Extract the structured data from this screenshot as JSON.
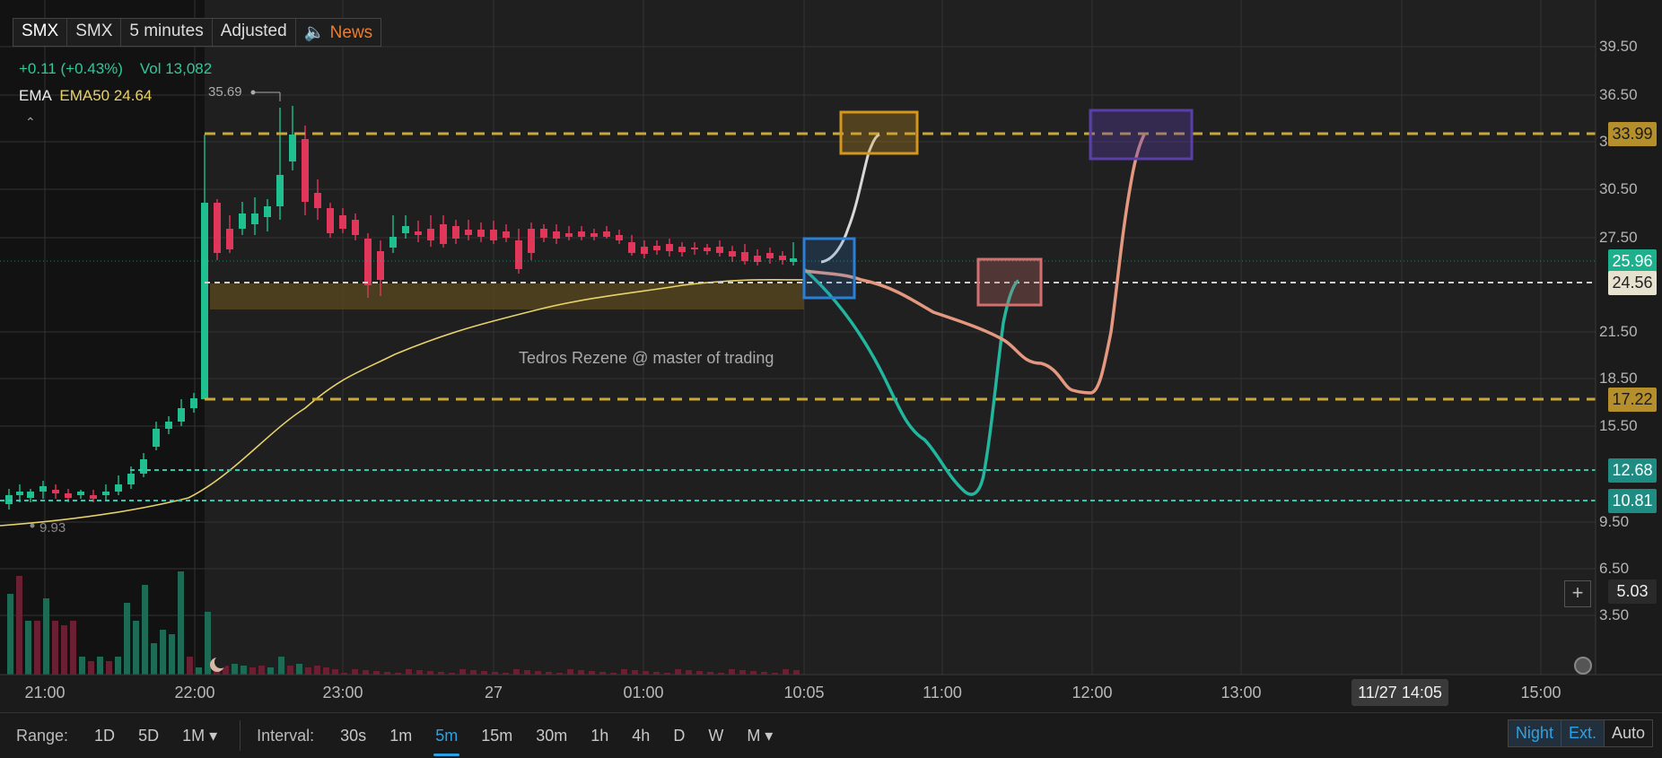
{
  "header": {
    "tabs": [
      "SMX",
      "SMX",
      "5 minutes",
      "Adjusted"
    ],
    "news_icon": "speaker-icon",
    "news_label": "News"
  },
  "info": {
    "change": "+0.11 (+0.43%)",
    "vol_label": "Vol",
    "vol_value": "13,082",
    "ema_label": "EMA",
    "ema_value": "EMA50 24.64"
  },
  "annotations": {
    "watermark": "Tedros Rezene @ master of trading",
    "high_label": "35.69",
    "low_label": "9.93"
  },
  "price_labels": {
    "p3399": "33.99",
    "p2596": "25.96",
    "p2456": "24.56",
    "p1722": "17.22",
    "p1268": "12.68",
    "p1081": "10.81",
    "p503": "5.03"
  },
  "y_ticks": [
    "39.50",
    "36.50",
    "33.50",
    "30.50",
    "27.50",
    "21.50",
    "18.50",
    "15.50",
    "9.50",
    "6.50",
    "3.50"
  ],
  "x_ticks": [
    "21:00",
    "22:00",
    "23:00",
    "27",
    "01:00",
    "10:05",
    "11:00",
    "12:00",
    "13:00",
    "15:00"
  ],
  "crosshair_time": "11/27 14:05",
  "bottom_bar": {
    "range_label": "Range:",
    "range": [
      "1D",
      "5D",
      "1M ▾"
    ],
    "interval_label": "Interval:",
    "intervals": [
      "30s",
      "1m",
      "5m",
      "15m",
      "30m",
      "1h",
      "4h",
      "D",
      "W",
      "M ▾"
    ],
    "active_interval": "5m",
    "modes": [
      "Night",
      "Ext.",
      "Auto"
    ]
  },
  "colors": {
    "bull": "#1fbf8f",
    "bear": "#e0365a",
    "ema": "#e8d26a",
    "level_gold": "#c9a83a",
    "level_teal": "#2ec9b0",
    "box_blue": "#2b7fd6",
    "box_orange": "#d4961e",
    "box_purple": "#5b3fa8",
    "box_red": "#d27070"
  },
  "chart_data": {
    "type": "candlestick",
    "symbol": "SMX",
    "interval": "5 minutes",
    "ylim": [
      0.5,
      41
    ],
    "levels": [
      33.99,
      25.96,
      24.56,
      17.22,
      12.68,
      10.81
    ],
    "ema50_last": 24.64,
    "volume_last": 13082,
    "annotations": [
      {
        "label": "Tedros Rezene @ master of trading"
      }
    ]
  }
}
